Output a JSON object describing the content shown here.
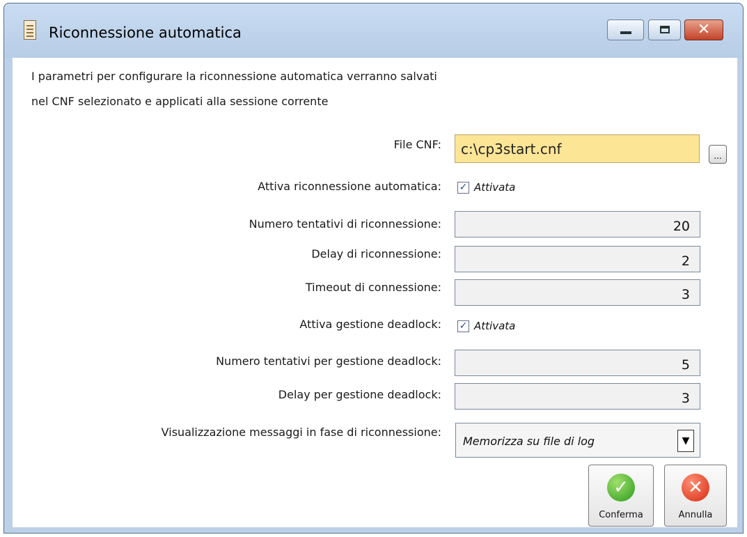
{
  "window": {
    "title": "Riconnessione automatica"
  },
  "intro": {
    "line1": "I parametri per configurare la riconnessione automatica verranno salvati",
    "line2": "nel CNF selezionato e applicati alla sessione corrente"
  },
  "form": {
    "file_label": "File CNF:",
    "file_value": "c:\\cp3start.cnf",
    "browse_label": "...",
    "auto_label": "Attiva riconnessione automatica:",
    "auto_check": "Attivata",
    "attempts_label": "Numero tentativi di riconnessione:",
    "attempts_value": "20",
    "delay_label": "Delay di riconnessione:",
    "delay_value": "2",
    "timeout_label": "Timeout di connessione:",
    "timeout_value": "3",
    "deadlock_label": "Attiva gestione deadlock:",
    "deadlock_check": "Attivata",
    "dl_attempts_label": "Numero tentativi per gestione deadlock:",
    "dl_attempts_value": "5",
    "dl_delay_label": "Delay per gestione deadlock:",
    "dl_delay_value": "3",
    "msg_label": "Visualizzazione messaggi in fase di riconnessione:",
    "msg_value": "Memorizza su file di log"
  },
  "buttons": {
    "confirm": "Conferma",
    "cancel": "Annulla"
  },
  "icons": {
    "checkmark": "✓",
    "cross": "✕",
    "dropdown": "▼"
  }
}
